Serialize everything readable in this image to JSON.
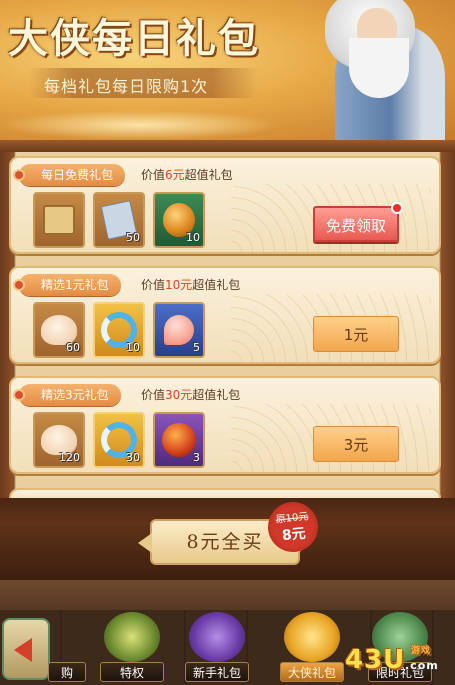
{
  "header": {
    "title": "大侠每日礼包",
    "subtitle": "每档礼包每日限购1次"
  },
  "packs": [
    {
      "tag": "每日免费礼包",
      "value_prefix": "价值",
      "value_amount": "6元",
      "value_suffix": "超值礼包",
      "items": [
        {
          "icon": "scroll-icon",
          "qty": ""
        },
        {
          "icon": "paper-icon",
          "qty": "50"
        },
        {
          "icon": "golden-fruit-icon",
          "qty": "10"
        }
      ],
      "button": "免费领取"
    },
    {
      "tag": "精选1元礼包",
      "value_prefix": "价值",
      "value_amount": "10元",
      "value_suffix": "超值礼包",
      "items": [
        {
          "icon": "bun-icon",
          "qty": "60"
        },
        {
          "icon": "fish-emblem-icon",
          "qty": "10"
        },
        {
          "icon": "peach-icon",
          "qty": "5"
        }
      ],
      "button": "1元"
    },
    {
      "tag": "精选3元礼包",
      "value_prefix": "价值",
      "value_amount": "30元",
      "value_suffix": "超值礼包",
      "items": [
        {
          "icon": "bun-icon",
          "qty": "120"
        },
        {
          "icon": "fish-emblem-icon",
          "qty": "30"
        },
        {
          "icon": "red-gem-icon",
          "qty": "3"
        }
      ],
      "button": "3元"
    }
  ],
  "buy_all": {
    "label": "8元全买",
    "original_price": "原10元",
    "current_price": "8元"
  },
  "tabs": [
    {
      "label": "购"
    },
    {
      "label": "特权"
    },
    {
      "label": "新手礼包"
    },
    {
      "label": "大侠礼包"
    },
    {
      "label": "限时礼包"
    }
  ],
  "watermark": {
    "main": "43U",
    "sub": "游戏",
    "domain": ".com"
  },
  "colors": {
    "accent": "#e2401e",
    "free_button": "#e85a52",
    "pay_button": "#f2a64c",
    "active_tab": "#e9a543"
  }
}
